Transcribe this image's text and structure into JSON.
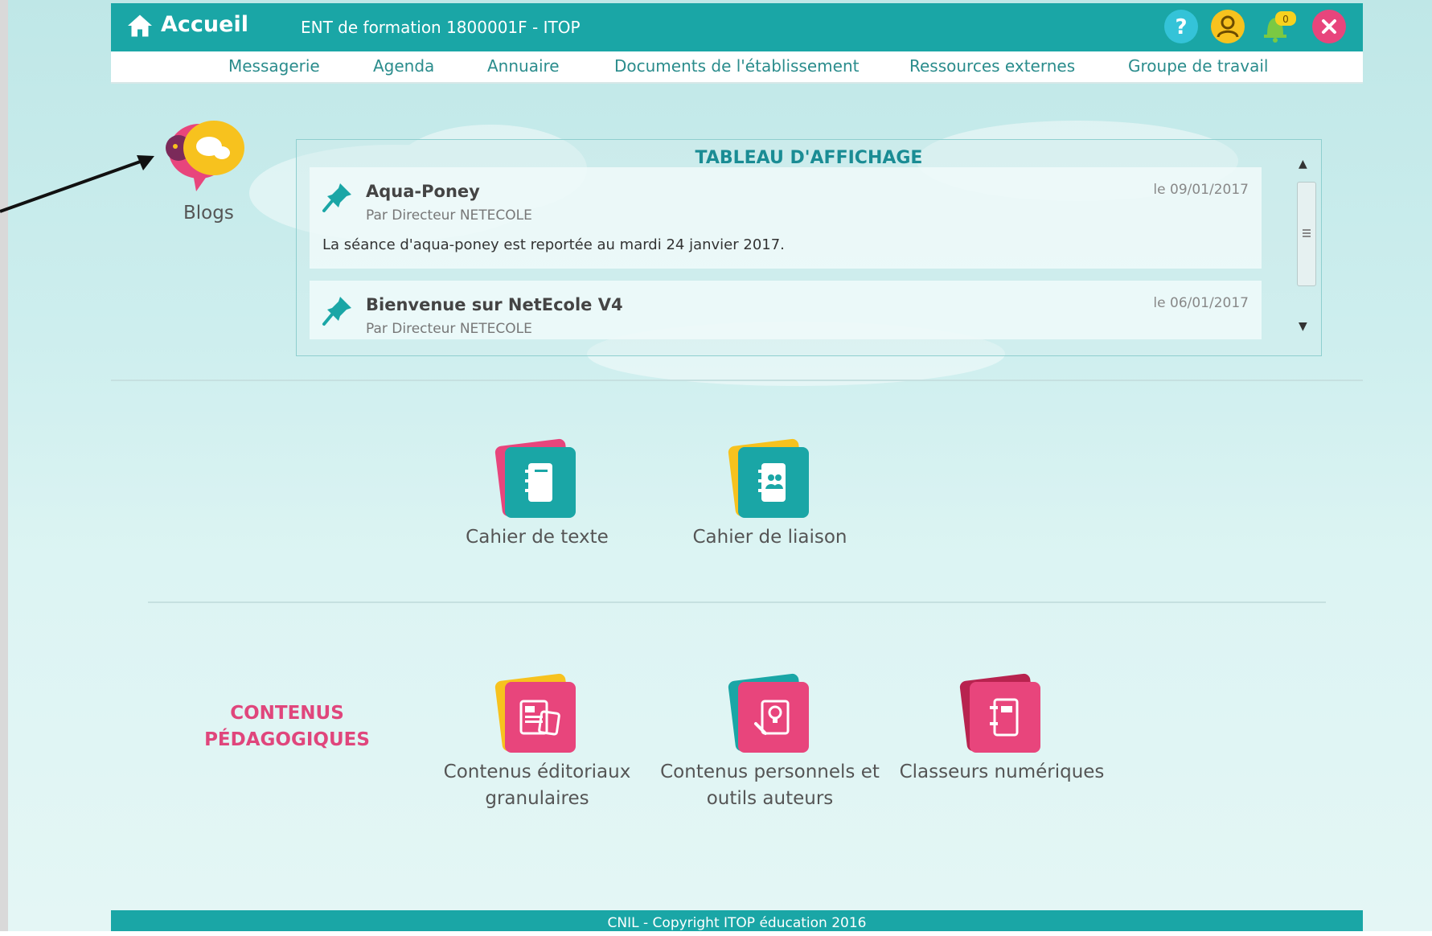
{
  "header": {
    "brand": "Accueil",
    "ent_label": "ENT de formation 1800001F - ITOP",
    "notification_count": "0"
  },
  "nav": {
    "items": [
      {
        "label": "Messagerie"
      },
      {
        "label": "Agenda"
      },
      {
        "label": "Annuaire"
      },
      {
        "label": "Documents de l'établissement"
      },
      {
        "label": "Ressources externes"
      },
      {
        "label": "Groupe de travail"
      }
    ]
  },
  "blogs": {
    "label": "Blogs"
  },
  "board": {
    "title": "TABLEAU D'AFFICHAGE",
    "messages": [
      {
        "title": "Aqua-Poney",
        "author": "Par Directeur NETECOLE",
        "date": "le 09/01/2017",
        "body": "La séance d'aqua-poney est reportée au mardi 24 janvier 2017."
      },
      {
        "title": "Bienvenue sur NetEcole V4",
        "author": "Par Directeur NETECOLE",
        "date": "le 06/01/2017",
        "body": ""
      }
    ]
  },
  "apps_top": [
    {
      "label": "Cahier de texte",
      "icon": "notebook-icon"
    },
    {
      "label": "Cahier de liaison",
      "icon": "liaison-book-icon"
    }
  ],
  "contenus": {
    "title_line1": "CONTENUS",
    "title_line2": "PÉDAGOGIQUES",
    "apps": [
      {
        "label_line1": "Contenus éditoriaux",
        "label_line2": "granulaires",
        "icon": "editorial-content-icon"
      },
      {
        "label_line1": "Contenus personnels et",
        "label_line2": "outils auteurs",
        "icon": "author-tools-icon"
      },
      {
        "label_line1": "Classeurs numériques",
        "label_line2": "",
        "icon": "digital-binder-icon"
      }
    ]
  },
  "footer": {
    "text": "CNIL - Copyright ITOP éducation 2016"
  },
  "colors": {
    "teal": "#1aa6a6",
    "pink": "#e8457c",
    "yellow": "#f7c21e",
    "header_text": "#ffffff"
  }
}
